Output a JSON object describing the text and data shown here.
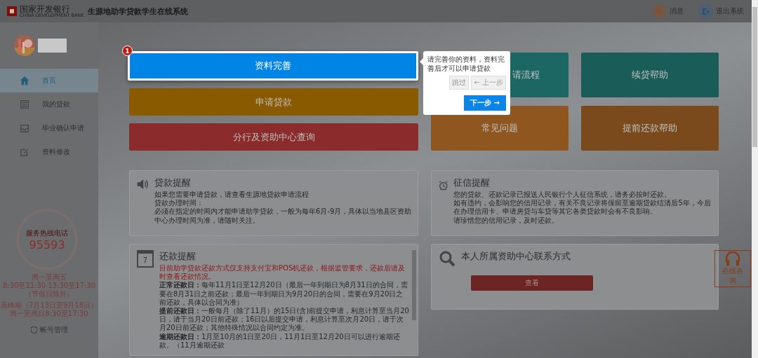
{
  "header": {
    "bank_name": "国家开发银行",
    "bank_name_en": "CHINA DEVELOPMENT BANK",
    "system_title": "生源地助学贷款学生在线系统",
    "actions": [
      {
        "kind": "bell",
        "label": "消息"
      },
      {
        "kind": "logout",
        "label": "退出系统"
      }
    ]
  },
  "sidebar": {
    "items": [
      {
        "kind": "home",
        "label": "首页",
        "selected": true
      },
      {
        "kind": "list",
        "label": "我的贷款",
        "selected": false
      },
      {
        "kind": "inbox",
        "label": "毕业确认申请",
        "selected": false
      },
      {
        "kind": "edit",
        "label": "资料修改",
        "selected": false
      }
    ],
    "hotline": {
      "caption": "服务热线电话",
      "number": "95593",
      "hours": [
        "周一至周五",
        "8:30至11:30 13:30至17:30",
        "（节假日除外）"
      ],
      "peak": [
        "高峰期（7月13日至9月18日）",
        "周一至周日8:30至17:30"
      ]
    },
    "account": "帐号管理"
  },
  "left_tiles": [
    {
      "label": "资料完善",
      "color": "#0084e6",
      "highlighted": true
    },
    {
      "label": "申请贷款",
      "color": "#8a5a00",
      "highlighted": false
    },
    {
      "label": "分行及资助中心查询",
      "color": "#8c2b2b",
      "highlighted": false
    }
  ],
  "right_tiles": [
    {
      "label": "请流程",
      "color": "#1c6663"
    },
    {
      "label": "续贷帮助",
      "color": "#195c58"
    },
    {
      "label": "常见问题",
      "color": "#8f571f"
    },
    {
      "label": "提前还款帮助",
      "color": "#7a4a1c"
    }
  ],
  "step_badge": "1",
  "tour_popover": {
    "text": "请完善你的资料，资料完善后才可以申请贷款",
    "buttons": [
      {
        "label": "跳过",
        "disabled": true
      },
      {
        "label": "← 上一步",
        "disabled": true
      },
      {
        "label": "下一步 →",
        "disabled": false
      }
    ]
  },
  "cards": [
    {
      "kind": "speaker",
      "title": "贷款提醒",
      "lines": [
        "如果您需要申请贷款，请查看生源地贷款申请流程",
        "贷款办理时间：",
        "必须在指定的时间内才能申请助学贷款，一般为每年6月-9月，具体以当地县区资助中心办理时间为准，请随时关注。"
      ]
    },
    {
      "kind": "alarm",
      "title": "征信提醒",
      "lines": [
        "您的贷款、还款记录已报送人民银行个人征信系统，请务必按时还款。",
        "如有违约，会影响您的信用记录，有关不良记录将保留至逾期贷款结清后5年，今后在办理信用卡、申请房贷与车贷等其它各类贷款时会有不良影响。",
        "请珍惜您的信用记录，及时还款。"
      ]
    },
    {
      "kind": "calendar",
      "title": "还款提醒",
      "calendar_day": "7",
      "lines": [
        "目前助学贷款还款方式仅支持支付宝和POS机还款，根据监管要求，还款后请及时查看还款情况。",
        "**正常还款日：**每年11月1日至12月20日（最后一年到期日为8月31日的合同，需要在8月31日之前还款；最后一年到期日为9月20日的合同，需要在9月20日之前还款，具体以合同为准）",
        "**提前还款日：**一般每月（除了11月）的15日(含)前提交申请，利息计算至当月20日，请于当月20日前还款；16日以后提交申请，利息计算至次月20日，请于次月20日前还款；其他特殊情况以合同约定为准。",
        "**逾期还款日：**1月至10月的1日至20日，11月1日至12月20日可以进行逾期还款。（11月逾期还款"
      ]
    },
    {
      "kind": "search",
      "title": "本人所属资助中心联系方式",
      "button": "查看"
    }
  ],
  "consult": {
    "label": "在线咨询"
  }
}
